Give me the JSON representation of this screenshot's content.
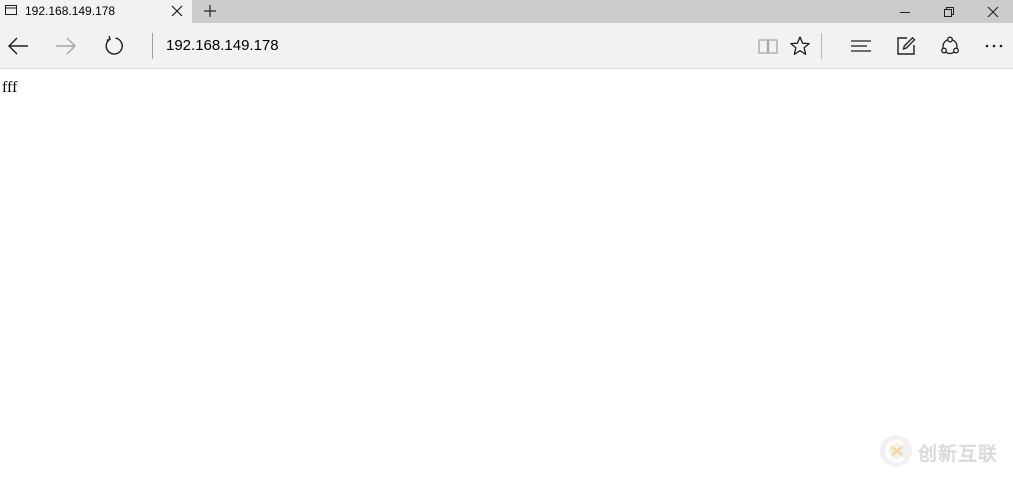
{
  "tab": {
    "title": "192.168.149.178"
  },
  "toolbar": {
    "address": "192.168.149.178"
  },
  "page": {
    "body_text": "fff"
  },
  "watermark": {
    "text": "创新互联"
  },
  "colors": {
    "tabstrip_bg": "#cccccc",
    "toolbar_bg": "#f2f2f2",
    "icon": "#1f1f1f",
    "icon_disabled": "#a6a6a6",
    "watermark": "#bdbdbd"
  }
}
